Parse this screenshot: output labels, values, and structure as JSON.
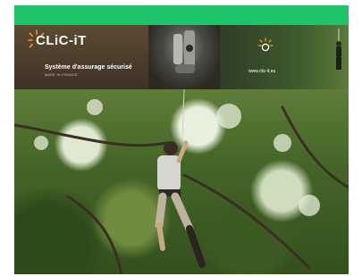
{
  "colors": {
    "topbar": "#1ec46a",
    "logo_accent": "#f29b1f"
  },
  "banner": {
    "logo_text": "CLiC-iT",
    "tagline": "Système d'assurage sécurisé",
    "made_in": "MADE IN FRANCE",
    "url": "www.clic-it.eu"
  }
}
